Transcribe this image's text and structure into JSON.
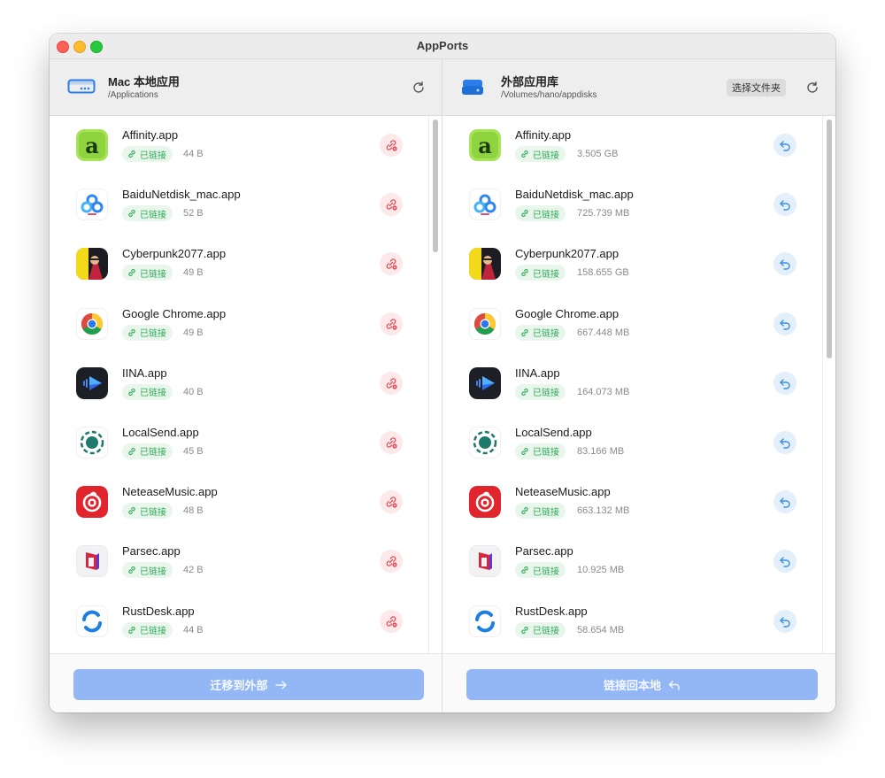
{
  "window": {
    "title": "AppPorts"
  },
  "left_pane": {
    "title": "Mac 本地应用",
    "path": "/Applications",
    "action_label": "迁移到外部",
    "apps": [
      {
        "name": "Affinity.app",
        "status": "已链接",
        "size": "44 B"
      },
      {
        "name": "BaiduNetdisk_mac.app",
        "status": "已链接",
        "size": "52 B"
      },
      {
        "name": "Cyberpunk2077.app",
        "status": "已链接",
        "size": "49 B"
      },
      {
        "name": "Google Chrome.app",
        "status": "已链接",
        "size": "49 B"
      },
      {
        "name": "IINA.app",
        "status": "已链接",
        "size": "40 B"
      },
      {
        "name": "LocalSend.app",
        "status": "已链接",
        "size": "45 B"
      },
      {
        "name": "NeteaseMusic.app",
        "status": "已链接",
        "size": "48 B"
      },
      {
        "name": "Parsec.app",
        "status": "已链接",
        "size": "42 B"
      },
      {
        "name": "RustDesk.app",
        "status": "已链接",
        "size": "44 B"
      }
    ]
  },
  "right_pane": {
    "title": "外部应用库",
    "path": "/Volumes/hano/appdisks",
    "choose_folder_label": "选择文件夹",
    "action_label": "链接回本地",
    "apps": [
      {
        "name": "Affinity.app",
        "status": "已链接",
        "size": "3.505 GB"
      },
      {
        "name": "BaiduNetdisk_mac.app",
        "status": "已链接",
        "size": "725.739 MB"
      },
      {
        "name": "Cyberpunk2077.app",
        "status": "已链接",
        "size": "158.655 GB"
      },
      {
        "name": "Google Chrome.app",
        "status": "已链接",
        "size": "667.448 MB"
      },
      {
        "name": "IINA.app",
        "status": "已链接",
        "size": "164.073 MB"
      },
      {
        "name": "LocalSend.app",
        "status": "已链接",
        "size": "83.166 MB"
      },
      {
        "name": "NeteaseMusic.app",
        "status": "已链接",
        "size": "663.132 MB"
      },
      {
        "name": "Parsec.app",
        "status": "已链接",
        "size": "10.925 MB"
      },
      {
        "name": "RustDesk.app",
        "status": "已链接",
        "size": "58.654 MB"
      }
    ]
  },
  "colors": {
    "accent": "#93b6f5",
    "linked_green": "#2fa857",
    "unlink_red": "#e0505a",
    "relink_blue": "#3b8fe0"
  },
  "icons": {
    "app_icons": [
      "affinity-icon",
      "baidunetdisk-icon",
      "cyberpunk-icon",
      "chrome-icon",
      "iina-icon",
      "localsend-icon",
      "neteasemusic-icon",
      "parsec-icon",
      "rustdesk-icon"
    ]
  }
}
